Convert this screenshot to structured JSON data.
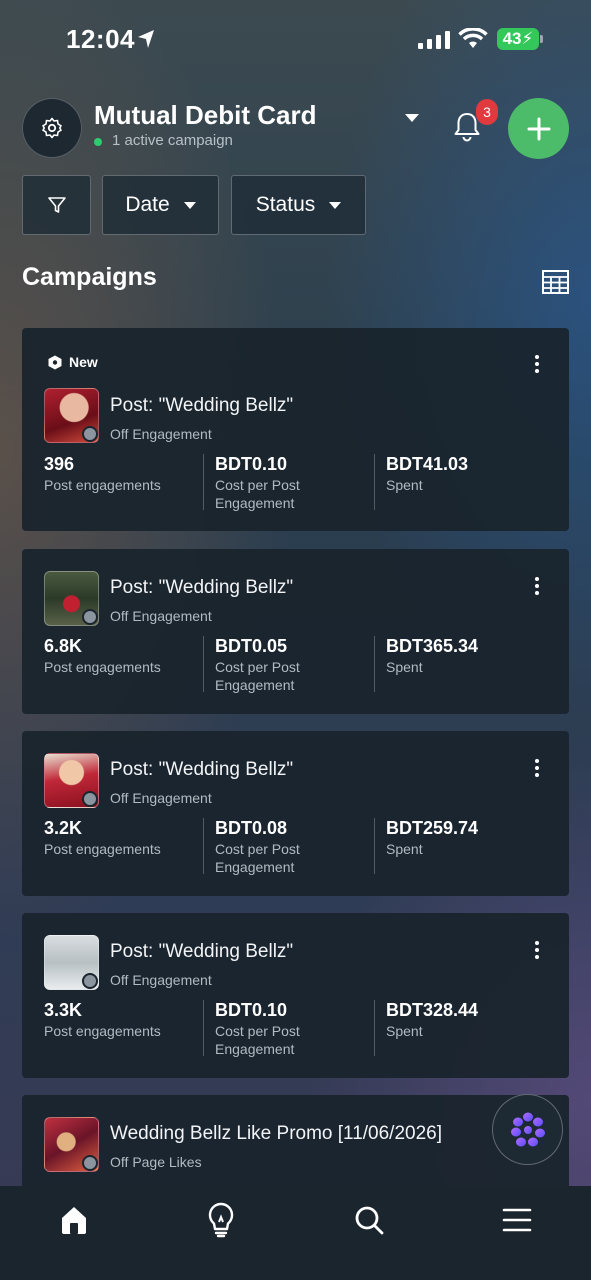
{
  "status_bar": {
    "time": "12:04",
    "battery": "43"
  },
  "header": {
    "account_name": "Mutual Debit Card",
    "active_status": "1 active campaign",
    "notification_count": "3"
  },
  "filters": {
    "date_label": "Date",
    "status_label": "Status"
  },
  "section_title": "Campaigns",
  "new_badge": "New",
  "campaigns": [
    {
      "title": "Post: \"Wedding Bellz\"",
      "status": "Off",
      "objective": "Engagement",
      "metrics": [
        {
          "value": "396",
          "label": "Post engagements"
        },
        {
          "value": "BDT0.10",
          "label": "Cost per Post Engagement"
        },
        {
          "value": "BDT41.03",
          "label": "Spent"
        }
      ]
    },
    {
      "title": "Post: \"Wedding Bellz\"",
      "status": "Off",
      "objective": "Engagement",
      "metrics": [
        {
          "value": "6.8K",
          "label": "Post engagements"
        },
        {
          "value": "BDT0.05",
          "label": "Cost per Post Engagement"
        },
        {
          "value": "BDT365.34",
          "label": "Spent"
        }
      ]
    },
    {
      "title": "Post: \"Wedding Bellz\"",
      "status": "Off",
      "objective": "Engagement",
      "metrics": [
        {
          "value": "3.2K",
          "label": "Post engagements"
        },
        {
          "value": "BDT0.08",
          "label": "Cost per Post Engagement"
        },
        {
          "value": "BDT259.74",
          "label": "Spent"
        }
      ]
    },
    {
      "title": "Post: \"Wedding Bellz\"",
      "status": "Off",
      "objective": "Engagement",
      "metrics": [
        {
          "value": "3.3K",
          "label": "Post engagements"
        },
        {
          "value": "BDT0.10",
          "label": "Cost per Post Engagement"
        },
        {
          "value": "BDT328.44",
          "label": "Spent"
        }
      ]
    },
    {
      "title": "Wedding Bellz Like Promo [11/06/2026]",
      "status": "Off",
      "objective": "Page Likes"
    }
  ],
  "tabs": [
    {
      "name": "home-icon",
      "active": true
    },
    {
      "name": "lightbulb-icon",
      "active": false
    },
    {
      "name": "search-icon",
      "active": false
    },
    {
      "name": "menu-icon",
      "active": false
    }
  ],
  "colors": {
    "accent_green": "#4cbb6a",
    "badge_red": "#e0393e",
    "card_bg": "#19242c"
  }
}
